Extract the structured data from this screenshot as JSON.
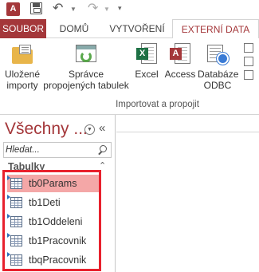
{
  "quick_access": {
    "app_icon_letter": "A",
    "icons": [
      "access-app-icon",
      "save-icon",
      "undo-icon",
      "redo-icon",
      "customize-qat-icon"
    ]
  },
  "tabs": {
    "file": "SOUBOR",
    "home": "DOMŮ",
    "create": "VYTVOŘENÍ",
    "external": "EXTERNÍ DATA"
  },
  "ribbon": {
    "saved_imports": [
      "Uložené",
      "importy"
    ],
    "linked_manager": [
      "Správce",
      "propojených tabulek"
    ],
    "excel": "Excel",
    "access": "Access",
    "odbc": [
      "Databáze",
      "ODBC"
    ],
    "excel_badge": "X",
    "access_badge": "A",
    "group_label": "Importovat a propojit"
  },
  "nav": {
    "title": "Všechny ...",
    "search_placeholder": "Hledat...",
    "section_label": "Tabulky",
    "items": [
      {
        "label": "tb0Params"
      },
      {
        "label": "tb1Deti"
      },
      {
        "label": "tb1Oddeleni"
      },
      {
        "label": "tb1Pracovnik"
      },
      {
        "label": "tbqPracovnik"
      }
    ]
  },
  "colors": {
    "accent": "#a4373a",
    "selection": "#f4a7a7",
    "highlight_border": "#e8212d",
    "excel_green": "#1e7145"
  }
}
